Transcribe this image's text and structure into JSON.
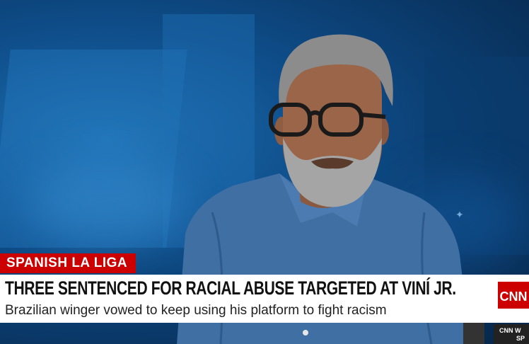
{
  "lower_third": {
    "category": "SPANISH LA LIGA",
    "headline": "THREE SENTENCED FOR RACIAL ABUSE TARGETED AT VINÍ JR.",
    "subheadline": "Brazilian winger vowed to keep using his platform to fight racism"
  },
  "network": {
    "logo_text": "CNN",
    "corner_line1": "CNN W",
    "corner_line2": "SP"
  },
  "colors": {
    "accent_red": "#cc0000",
    "band_white": "#ffffff",
    "studio_blue": "#0f4f8c"
  }
}
